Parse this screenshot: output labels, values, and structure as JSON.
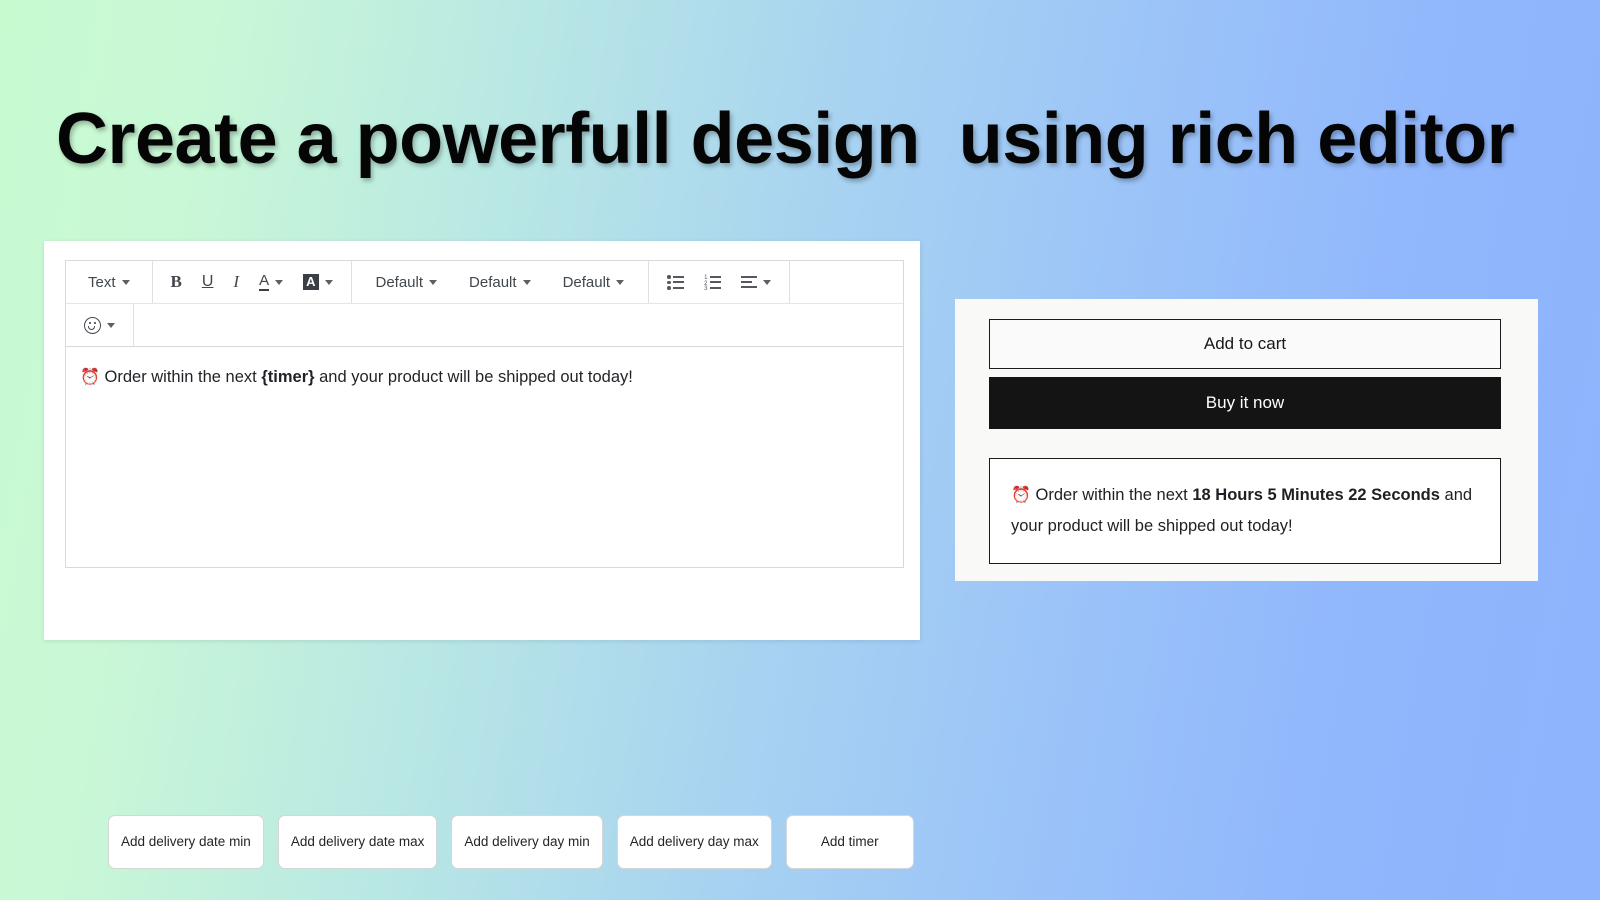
{
  "headline": "Create a powerfull design  using rich editor",
  "editor": {
    "toolbar": {
      "style_select": "Text",
      "bold": "B",
      "underline": "U",
      "italic": "I",
      "text_color": "A",
      "highlight_color": "A",
      "font_family": "Default",
      "font_size": "Default",
      "line_height": "Default"
    },
    "content": {
      "emoji": "⏰",
      "before": " Order within the next ",
      "token": "{timer}",
      "after": " and your product will be shipped out today!"
    },
    "buttons": [
      {
        "label": "Add delivery date min"
      },
      {
        "label": "Add delivery date max"
      },
      {
        "label": "Add delivery day min"
      },
      {
        "label": "Add delivery day max"
      },
      {
        "label": "Add timer"
      }
    ]
  },
  "preview": {
    "add_to_cart_label": "Add to cart",
    "buy_it_now_label": "Buy it now",
    "timer_message": {
      "emoji": "⏰",
      "before": " Order within the next ",
      "countdown": "18 Hours 5 Minutes 22 Seconds",
      "after": " and your product will be shipped out today!"
    }
  },
  "colors": {
    "gradient_start": "#c6fbd0",
    "gradient_end": "#8db4fd",
    "buy_button_bg": "#141414",
    "panel_bg": "#f9f9f7",
    "card_bg": "#ffffff"
  }
}
